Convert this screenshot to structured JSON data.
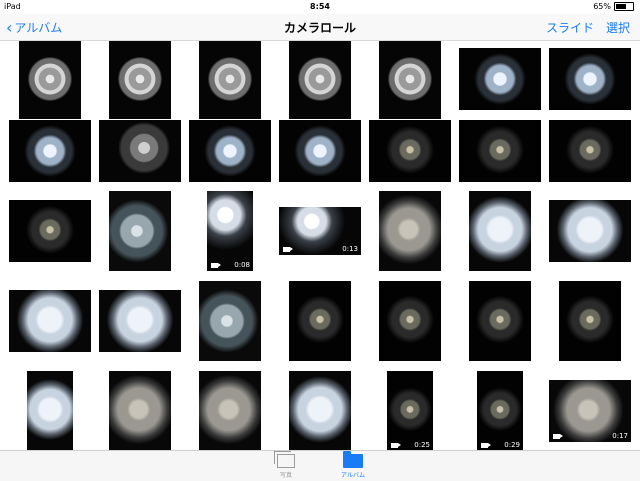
{
  "status_bar": {
    "device": "iPad",
    "time": "8:54",
    "battery": "65%",
    "battery_level": 0.65
  },
  "nav": {
    "back_label": "アルバム",
    "title": "カメラロール",
    "slideshow_label": "スライド",
    "select_label": "選択"
  },
  "thumbnails": [
    {
      "row": 0,
      "col": 0,
      "shape": "square",
      "style": "cluster",
      "video": false,
      "duration": ""
    },
    {
      "row": 0,
      "col": 1,
      "shape": "square",
      "style": "cluster",
      "video": false,
      "duration": ""
    },
    {
      "row": 0,
      "col": 2,
      "shape": "square",
      "style": "cluster",
      "video": false,
      "duration": ""
    },
    {
      "row": 0,
      "col": 3,
      "shape": "square",
      "style": "cluster",
      "video": false,
      "duration": ""
    },
    {
      "row": 0,
      "col": 4,
      "shape": "square",
      "style": "cluster",
      "video": false,
      "duration": ""
    },
    {
      "row": 0,
      "col": 5,
      "shape": "landscape",
      "style": "bright-small",
      "video": false,
      "duration": ""
    },
    {
      "row": 0,
      "col": 6,
      "shape": "landscape",
      "style": "bright-small",
      "video": false,
      "duration": ""
    },
    {
      "row": 1,
      "col": 0,
      "shape": "landscape",
      "style": "bright-small",
      "video": false,
      "duration": ""
    },
    {
      "row": 1,
      "col": 1,
      "shape": "landscape",
      "style": "cluster-dim",
      "video": false,
      "duration": ""
    },
    {
      "row": 1,
      "col": 2,
      "shape": "landscape",
      "style": "bright-small",
      "video": false,
      "duration": ""
    },
    {
      "row": 1,
      "col": 3,
      "shape": "landscape",
      "style": "bright-small",
      "video": false,
      "duration": ""
    },
    {
      "row": 1,
      "col": 4,
      "shape": "landscape",
      "style": "dim-small",
      "video": false,
      "duration": ""
    },
    {
      "row": 1,
      "col": 5,
      "shape": "landscape",
      "style": "dim-small",
      "video": false,
      "duration": ""
    },
    {
      "row": 1,
      "col": 6,
      "shape": "landscape",
      "style": "dim-small",
      "video": false,
      "duration": ""
    },
    {
      "row": 2,
      "col": 0,
      "shape": "landscape",
      "style": "dim-small",
      "video": false,
      "duration": ""
    },
    {
      "row": 2,
      "col": 1,
      "shape": "square",
      "style": "bubbles",
      "video": false,
      "duration": ""
    },
    {
      "row": 2,
      "col": 2,
      "shape": "portrait",
      "style": "flash",
      "video": true,
      "duration": "0:08"
    },
    {
      "row": 2,
      "col": 3,
      "shape": "wide",
      "style": "flash",
      "video": true,
      "duration": "0:13"
    },
    {
      "row": 2,
      "col": 4,
      "shape": "square",
      "style": "grey-field",
      "video": false,
      "duration": ""
    },
    {
      "row": 2,
      "col": 5,
      "shape": "square",
      "style": "pale-field",
      "video": false,
      "duration": ""
    },
    {
      "row": 2,
      "col": 6,
      "shape": "landscape",
      "style": "pale-field",
      "video": false,
      "duration": ""
    },
    {
      "row": 3,
      "col": 0,
      "shape": "landscape",
      "style": "pale-field",
      "video": false,
      "duration": ""
    },
    {
      "row": 3,
      "col": 1,
      "shape": "landscape",
      "style": "pale-field",
      "video": false,
      "duration": ""
    },
    {
      "row": 3,
      "col": 2,
      "shape": "square",
      "style": "bubbles",
      "video": false,
      "duration": ""
    },
    {
      "row": 3,
      "col": 3,
      "shape": "square",
      "style": "dim-small",
      "video": false,
      "duration": ""
    },
    {
      "row": 3,
      "col": 4,
      "shape": "square",
      "style": "dim-small",
      "video": false,
      "duration": ""
    },
    {
      "row": 3,
      "col": 5,
      "shape": "square",
      "style": "dim-small",
      "video": false,
      "duration": ""
    },
    {
      "row": 3,
      "col": 6,
      "shape": "square",
      "style": "dim-small",
      "video": false,
      "duration": ""
    },
    {
      "row": 4,
      "col": 0,
      "shape": "portrait",
      "style": "pale-field",
      "video": false,
      "duration": ""
    },
    {
      "row": 4,
      "col": 1,
      "shape": "square",
      "style": "grey-field",
      "video": false,
      "duration": ""
    },
    {
      "row": 4,
      "col": 2,
      "shape": "square",
      "style": "grey-field",
      "video": false,
      "duration": ""
    },
    {
      "row": 4,
      "col": 3,
      "shape": "square",
      "style": "pale-field",
      "video": false,
      "duration": ""
    },
    {
      "row": 4,
      "col": 4,
      "shape": "portrait",
      "style": "dim-small",
      "video": true,
      "duration": "0:25"
    },
    {
      "row": 4,
      "col": 5,
      "shape": "portrait",
      "style": "dim-small",
      "video": true,
      "duration": "0:29"
    },
    {
      "row": 4,
      "col": 6,
      "shape": "landscape",
      "style": "grey-field",
      "video": true,
      "duration": "0:17"
    }
  ],
  "tabs": [
    {
      "label": "写真",
      "active": false
    },
    {
      "label": "アルバム",
      "active": true
    }
  ],
  "colors": {
    "accent": "#1a7cf5",
    "inactive": "#9a9a9a"
  }
}
